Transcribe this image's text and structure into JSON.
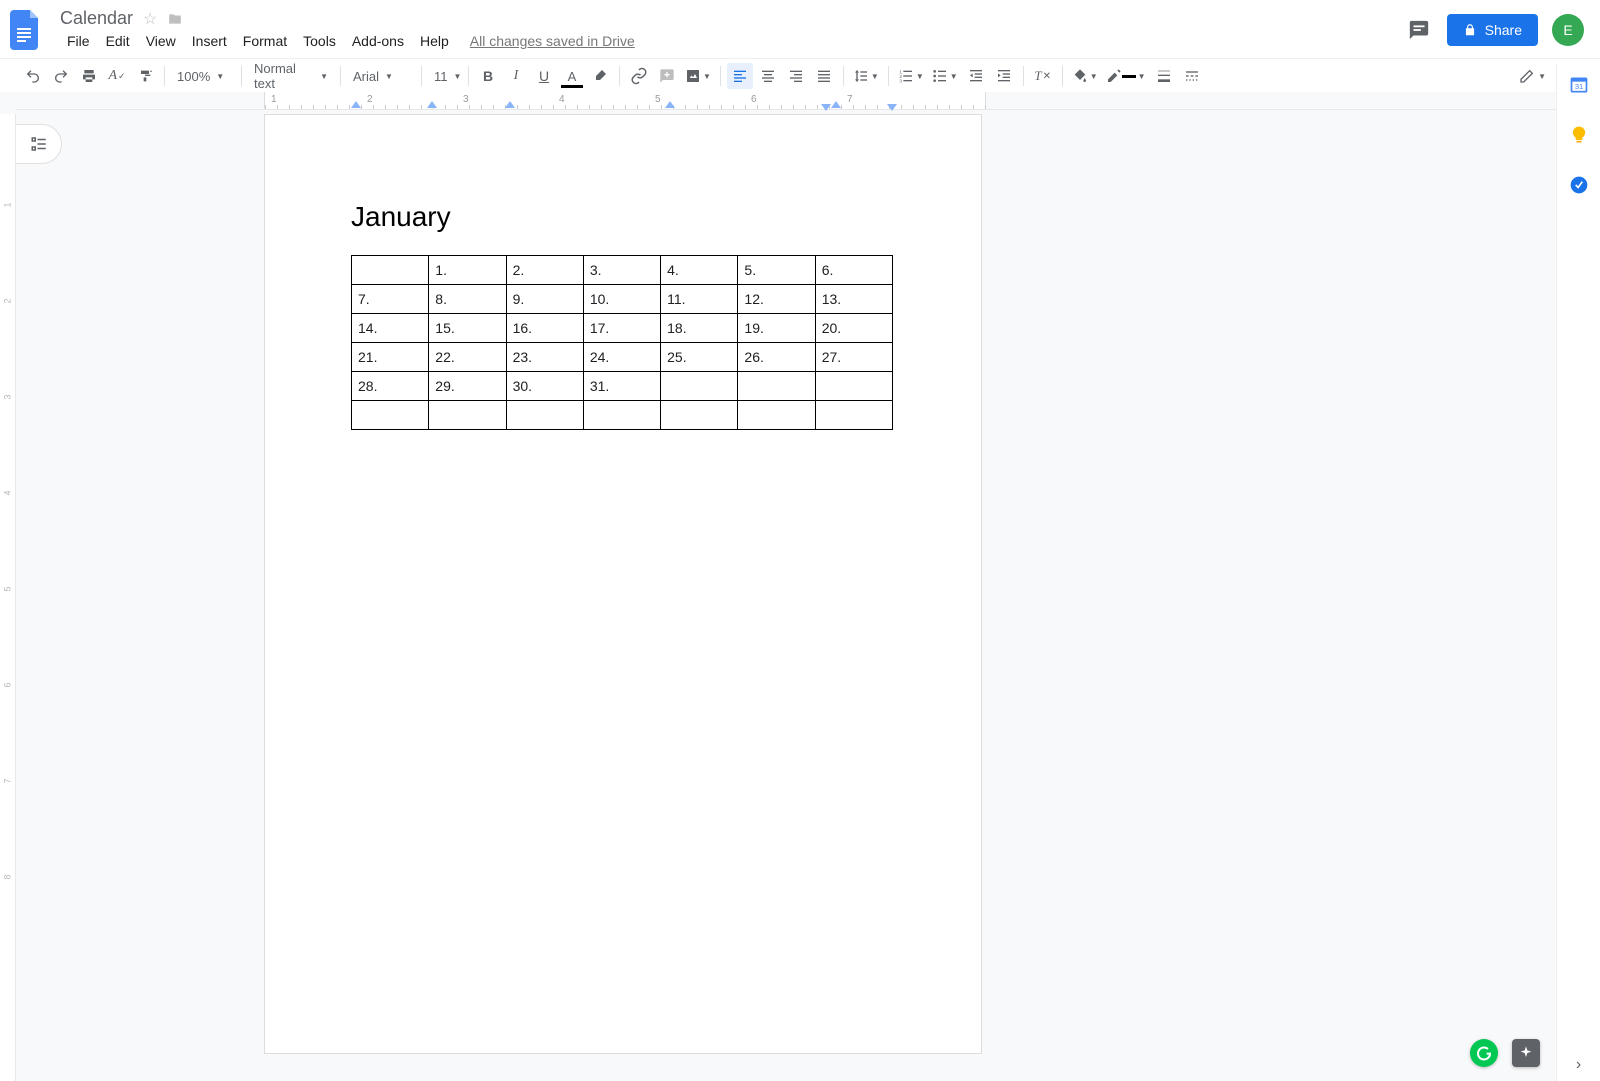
{
  "doc": {
    "title": "Calendar",
    "save_status": "All changes saved in Drive"
  },
  "menu": {
    "file": "File",
    "edit": "Edit",
    "view": "View",
    "insert": "Insert",
    "format": "Format",
    "tools": "Tools",
    "addons": "Add-ons",
    "help": "Help"
  },
  "share": {
    "label": "Share"
  },
  "avatar": {
    "initial": "E"
  },
  "toolbar": {
    "zoom": "100%",
    "style": "Normal text",
    "font": "Arial",
    "size": "11"
  },
  "hruler": {
    "numbers": [
      "1",
      "2",
      "3",
      "4",
      "5",
      "6",
      "7"
    ]
  },
  "vruler": {
    "numbers": [
      "1",
      "2",
      "3",
      "4",
      "5",
      "6",
      "7",
      "8"
    ]
  },
  "content": {
    "heading": "January",
    "table": [
      [
        "",
        "1.",
        "2.",
        "3.",
        "4.",
        "5.",
        "6."
      ],
      [
        "7.",
        "8.",
        "9.",
        "10.",
        "11.",
        "12.",
        "13."
      ],
      [
        "14.",
        "15.",
        "16.",
        "17.",
        "18.",
        "19.",
        "20."
      ],
      [
        "21.",
        "22.",
        "23.",
        "24.",
        "25.",
        "26.",
        "27."
      ],
      [
        "28.",
        "29.",
        "30.",
        "31.",
        "",
        "",
        ""
      ],
      [
        "",
        "",
        "",
        "",
        "",
        "",
        ""
      ]
    ]
  }
}
